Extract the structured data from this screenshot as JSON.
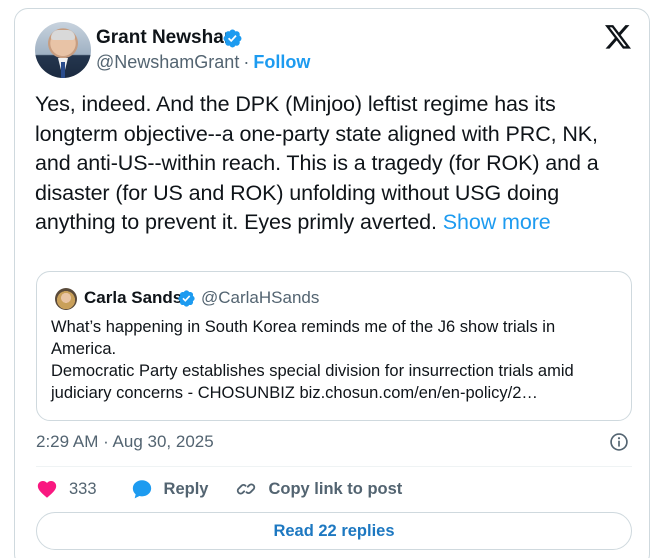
{
  "author": {
    "name": "Grant Newsham",
    "handle": "@NewshamGrant",
    "separator": "·",
    "follow_label": "Follow"
  },
  "tweet": {
    "text": "Yes, indeed.  And the DPK (Minjoo) leftist regime has its longterm objective--a one-party state aligned with PRC, NK, and anti-US--within reach.  This is a tragedy (for ROK) and a disaster (for US and ROK) unfolding without USG doing anything to prevent it.  Eyes primly averted. ",
    "show_more_label": "Show more",
    "timestamp": "2:29 AM · Aug 30, 2025"
  },
  "quote": {
    "name": "Carla Sands",
    "handle": "@CarlaHSands",
    "lines": [
      "What’s happening in South Korea reminds me of the J6 show trials in",
      "America.",
      "Democratic Party establishes special division for insurrection trials amid",
      "judiciary concerns - CHOSUNBIZ biz.chosun.com/en/en-policy/2…"
    ]
  },
  "actions": {
    "like_count": "333",
    "reply_label": "Reply",
    "copy_link_label": "Copy link to post"
  },
  "read_replies_label": "Read 22 replies",
  "colors": {
    "accent": "#1d9bf0",
    "like": "#f91880",
    "muted": "#536471",
    "border": "#cfd9de"
  },
  "icons": [
    "verified-badge-icon",
    "x-logo-icon",
    "info-icon",
    "heart-icon",
    "reply-bubble-icon",
    "link-icon"
  ]
}
